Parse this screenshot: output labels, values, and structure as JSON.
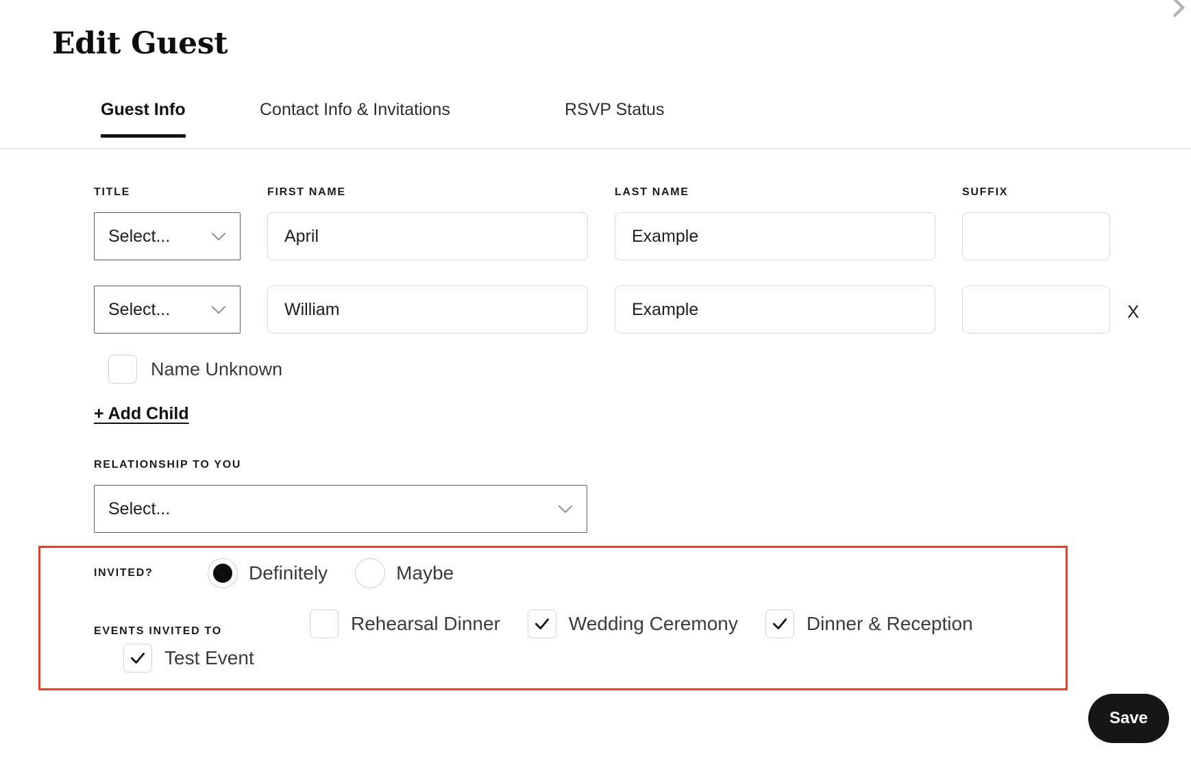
{
  "header": {
    "title": "Edit Guest",
    "close_icon": "chevron-right-icon"
  },
  "tabs": [
    {
      "label": "Guest Info",
      "active": true
    },
    {
      "label": "Contact Info & Invitations",
      "active": false
    },
    {
      "label": "RSVP Status",
      "active": false
    }
  ],
  "form": {
    "labels": {
      "title": "TITLE",
      "first_name": "FIRST NAME",
      "last_name": "LAST NAME",
      "suffix": "SUFFIX"
    },
    "rows": [
      {
        "title_value": "Select...",
        "first_name": "April",
        "last_name": "Example",
        "suffix": "",
        "removable": false
      },
      {
        "title_value": "Select...",
        "first_name": "William",
        "last_name": "Example",
        "suffix": "",
        "removable": true,
        "remove_label": "X"
      }
    ],
    "name_unknown": {
      "label": "Name Unknown",
      "checked": false
    },
    "add_child_label": "+ Add Child",
    "relationship": {
      "label": "RELATIONSHIP TO YOU",
      "value": "Select..."
    }
  },
  "invited": {
    "label": "INVITED?",
    "options": [
      {
        "label": "Definitely",
        "selected": true
      },
      {
        "label": "Maybe",
        "selected": false
      }
    ]
  },
  "events_invited_to": {
    "label": "EVENTS INVITED TO",
    "row1": [
      {
        "label": "Rehearsal Dinner",
        "checked": false
      },
      {
        "label": "Wedding Ceremony",
        "checked": true
      },
      {
        "label": "Dinner & Reception",
        "checked": true
      }
    ],
    "row2": [
      {
        "label": "Test Event",
        "checked": true
      }
    ]
  },
  "footer": {
    "save_label": "Save"
  },
  "colors": {
    "accent_highlight": "#ee3b23",
    "primary_dark": "#161616",
    "input_border": "#d8d8d8",
    "select_border": "#5c5c5c"
  }
}
